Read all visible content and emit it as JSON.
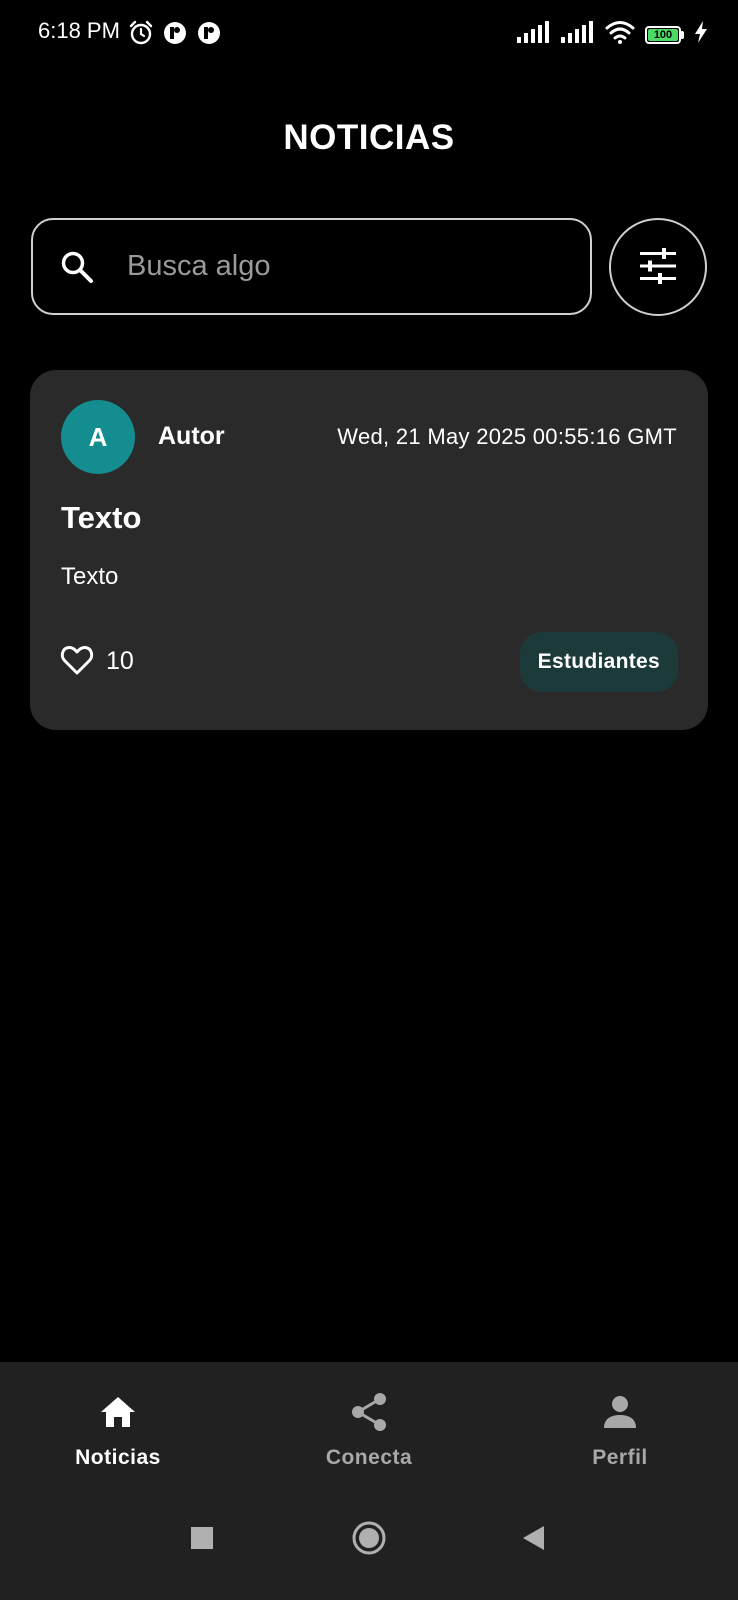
{
  "status_bar": {
    "time": "6:18 PM",
    "battery_level": "100",
    "icons": [
      "alarm-icon",
      "app-notification-icon",
      "app-notification-icon",
      "signal-icon",
      "signal-icon",
      "wifi-icon",
      "battery-icon",
      "charging-icon"
    ]
  },
  "header": {
    "title": "NOTICIAS"
  },
  "search": {
    "placeholder": "Busca algo",
    "value": ""
  },
  "news": [
    {
      "author_initial": "A",
      "author": "Autor",
      "date": "Wed, 21 May 2025 00:55:16 GMT",
      "title": "Texto",
      "body": "Texto",
      "likes": "10",
      "category": "Estudiantes"
    }
  ],
  "bottom_nav": {
    "items": [
      {
        "label": "Noticias",
        "icon": "home-icon",
        "active": true
      },
      {
        "label": "Conecta",
        "icon": "share-icon",
        "active": false
      },
      {
        "label": "Perfil",
        "icon": "person-icon",
        "active": false
      }
    ]
  },
  "colors": {
    "background": "#000000",
    "card": "#2a2a2a",
    "avatar": "#138d8f",
    "chip": "#1c3a3a",
    "nav": "#212121",
    "battery": "#4cd964"
  }
}
